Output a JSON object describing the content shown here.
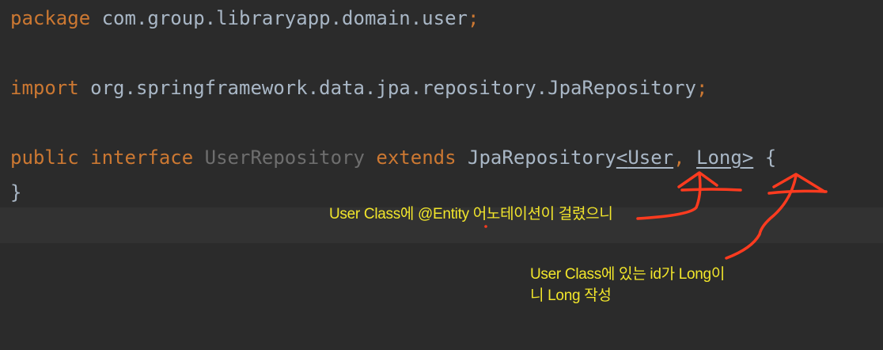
{
  "code": {
    "line1": {
      "kw": "package",
      "rest": " com.group.libraryapp.domain.user",
      "semi": ";"
    },
    "line2": {
      "kw": "import",
      "rest": " org.springframework.data.jpa.repository.JpaRepository",
      "semi": ";"
    },
    "line3": {
      "kw_public": "public",
      "kw_interface": "interface",
      "name": "UserRepository",
      "kw_extends": "extends",
      "base": "JpaRepository",
      "open": "<",
      "type1": "User",
      "comma": ",",
      "type2": "Long",
      "close": ">",
      "brace": " {"
    },
    "line4": "}"
  },
  "annotations": {
    "note1": "User Class에 @Entity 어노테이션이 걸렸으니",
    "note2_line1": "User Class에 있는 id가 Long이",
    "note2_line2": "니 Long 작성"
  },
  "colors": {
    "background": "#2b2b2b",
    "keyword": "#cc7832",
    "text": "#a9b7c6",
    "dimmed": "#6e6e6e",
    "annotation_text": "#f2e62b",
    "annotation_ink": "#ff3b1f"
  }
}
